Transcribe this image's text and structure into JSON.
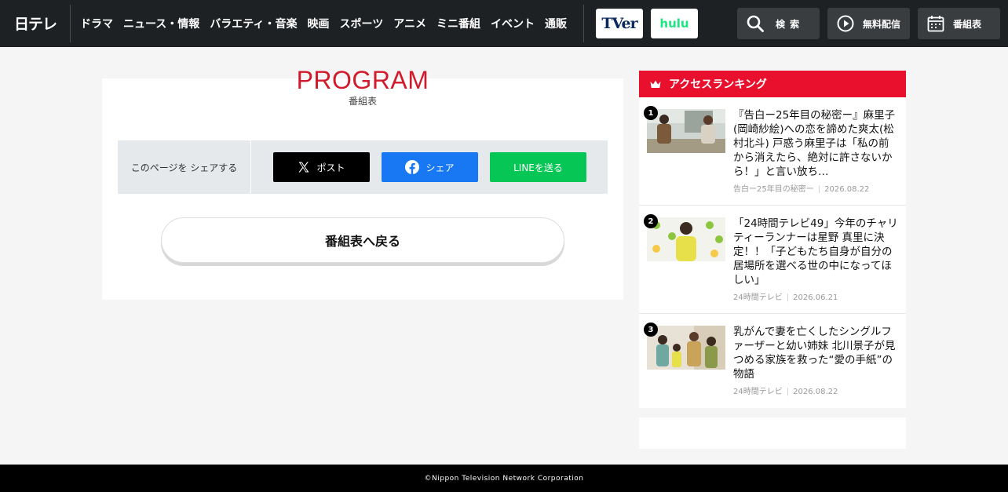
{
  "header": {
    "logo": "日テレ",
    "nav": [
      "ドラマ",
      "ニュース・情報",
      "バラエティ・音楽",
      "映画",
      "スポーツ",
      "アニメ",
      "ミニ番組",
      "イベント",
      "通販"
    ],
    "partners": {
      "tver": "TVer",
      "hulu": "hulu"
    },
    "buttons": {
      "search": "検 索",
      "stream": "無料配信",
      "guide": "番組表"
    }
  },
  "main": {
    "title": "PROGRAM",
    "subtitle": "番組表",
    "share": {
      "label": "このページを シェアする",
      "x": "ポスト",
      "facebook": "シェア",
      "line": "LINEを送る"
    },
    "back_button": "番組表へ戻る"
  },
  "ranking": {
    "heading": "アクセスランキング",
    "items": [
      {
        "rank": "1",
        "title": "『告白ー25年目の秘密ー』麻里子(岡崎紗絵)への恋を諦めた爽太(松村北斗) 戸惑う麻里子は「私の前から消えたら、絶対に許さないから！」と言い放ち…",
        "category": "告白ー25年目の秘密ー",
        "date": "2026.08.22"
      },
      {
        "rank": "2",
        "title": "「24時間テレビ49」今年のチャリティーランナーは星野 真里に決定！！「子どもたち自身が自分の居場所を選べる世の中になってほしい」",
        "category": "24時間テレビ",
        "date": "2026.06.21"
      },
      {
        "rank": "3",
        "title": "乳がんで妻を亡くしたシングルファーザーと幼い姉妹 北川景子が見つめる家族を救った“愛の手紙”の物語",
        "category": "24時間テレビ",
        "date": "2026.08.22"
      }
    ]
  },
  "footer": {
    "copyright": "©Nippon Television Network Corporation"
  },
  "colors": {
    "header_bg": "#1e2123",
    "accent_red": "#e8102d",
    "program_red": "#d11b2c",
    "x": "#000000",
    "facebook": "#1877f2",
    "line": "#06c755"
  }
}
